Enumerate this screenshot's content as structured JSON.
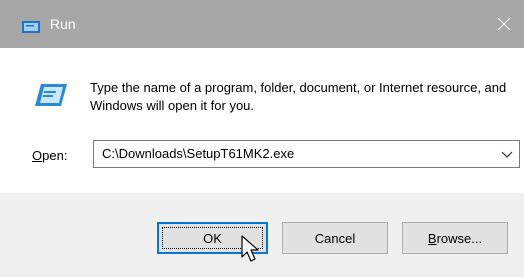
{
  "window": {
    "title": "Run",
    "close_glyph": "✕",
    "title_icon": "run-icon",
    "close_icon": "close-icon"
  },
  "content": {
    "app_icon": "run-app-icon",
    "description": "Type the name of a program, folder, document, or Internet resource, and Windows will open it for you."
  },
  "open": {
    "label_prefix": "",
    "label_underlined": "O",
    "label_rest": "pen:",
    "value": "C:\\Downloads\\SetupT61MK2.exe",
    "dropdown_icon": "chevron-down-icon"
  },
  "buttons": {
    "ok": "OK",
    "cancel": "Cancel",
    "browse_underlined": "B",
    "browse_rest": "rowse..."
  },
  "colors": {
    "titlebar": "#a6a6a6",
    "content_bg": "#ffffff",
    "footer_bg": "#f0f0f0",
    "focus_border": "#0078d7"
  }
}
